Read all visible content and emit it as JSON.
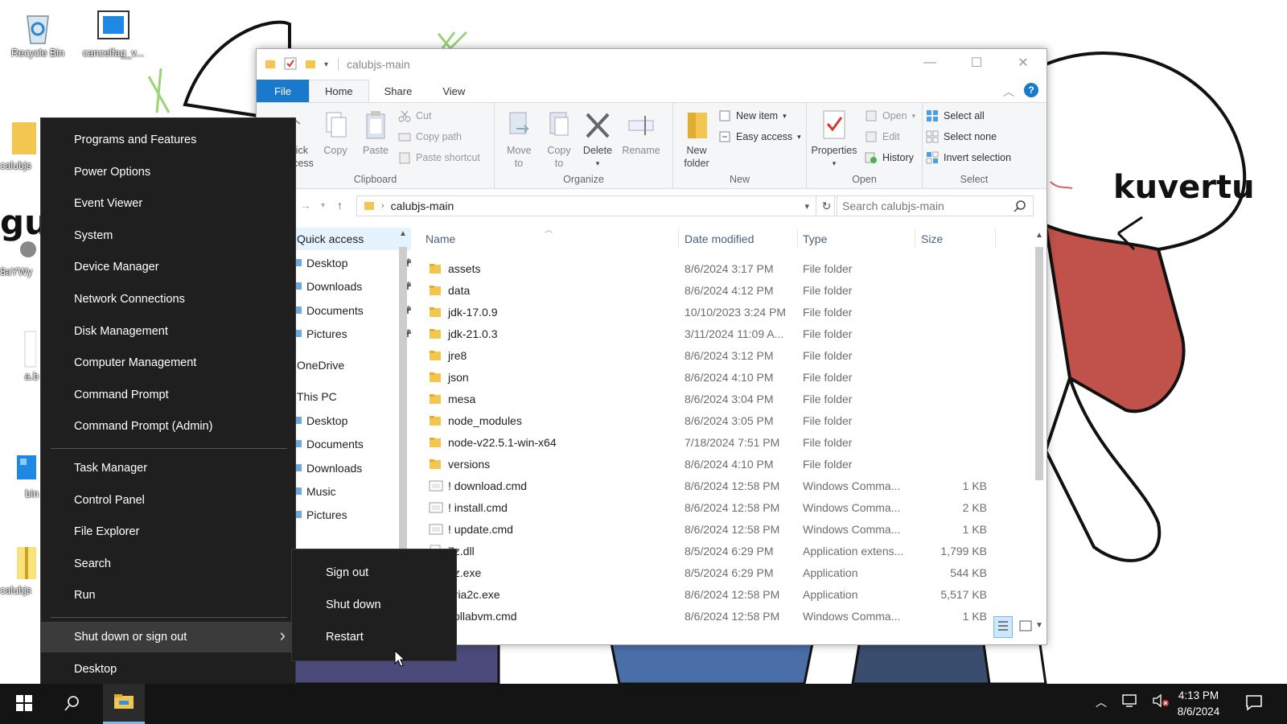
{
  "desktop": {
    "icons": [
      {
        "label": "Recycle Bin",
        "icon": "recycle-bin-icon"
      },
      {
        "label": "cancelfag_v...",
        "icon": "app-icon"
      },
      {
        "label": "calubjs",
        "icon": "folder-icon"
      },
      {
        "label": "8aYWy",
        "icon": "app-icon"
      },
      {
        "label": "a.b",
        "icon": "file-icon"
      },
      {
        "label": "bin",
        "icon": "package-icon"
      },
      {
        "label": "calubjs",
        "icon": "zip-folder-icon"
      }
    ],
    "wallpaper_text": {
      "left": "gu",
      "right": "kuvertu"
    }
  },
  "explorer": {
    "title": "calubjs-main",
    "tabs": [
      "File",
      "Home",
      "Share",
      "View"
    ],
    "ribbon": {
      "clipboard": {
        "group": "Clipboard",
        "quick_access": "Quick access",
        "copy": "Copy",
        "paste": "Paste",
        "cut": "Cut",
        "copy_path": "Copy path",
        "paste_shortcut": "Paste shortcut"
      },
      "organize": {
        "group": "Organize",
        "move_to": "Move to",
        "copy_to": "Copy to",
        "delete": "Delete",
        "rename": "Rename"
      },
      "new": {
        "group": "New",
        "new_folder": "New folder",
        "new_item": "New item",
        "easy_access": "Easy access"
      },
      "open": {
        "group": "Open",
        "properties": "Properties",
        "open": "Open",
        "edit": "Edit",
        "history": "History"
      },
      "select": {
        "group": "Select",
        "select_all": "Select all",
        "select_none": "Select none",
        "invert_selection": "Invert selection"
      }
    },
    "address": "calubjs-main",
    "search_placeholder": "Search calubjs-main",
    "nav": [
      {
        "label": "Quick access",
        "indent": 0,
        "pinned": false,
        "selected": true
      },
      {
        "label": "Desktop",
        "indent": 1,
        "pinned": true
      },
      {
        "label": "Downloads",
        "indent": 1,
        "pinned": true
      },
      {
        "label": "Documents",
        "indent": 1,
        "pinned": true
      },
      {
        "label": "Pictures",
        "indent": 1,
        "pinned": true
      },
      {
        "label": "OneDrive",
        "indent": 0,
        "pinned": false
      },
      {
        "label": "This PC",
        "indent": 0,
        "pinned": false
      },
      {
        "label": "Desktop",
        "indent": 1,
        "pinned": false
      },
      {
        "label": "Documents",
        "indent": 1,
        "pinned": false
      },
      {
        "label": "Downloads",
        "indent": 1,
        "pinned": false
      },
      {
        "label": "Music",
        "indent": 1,
        "pinned": false
      },
      {
        "label": "Pictures",
        "indent": 1,
        "pinned": false
      }
    ],
    "columns": {
      "name": "Name",
      "date": "Date modified",
      "type": "Type",
      "size": "Size"
    },
    "files": [
      {
        "name": "assets",
        "date": "8/6/2024 3:17 PM",
        "type": "File folder",
        "size": "",
        "kind": "folder"
      },
      {
        "name": "data",
        "date": "8/6/2024 4:12 PM",
        "type": "File folder",
        "size": "",
        "kind": "folder"
      },
      {
        "name": "jdk-17.0.9",
        "date": "10/10/2023 3:24 PM",
        "type": "File folder",
        "size": "",
        "kind": "folder"
      },
      {
        "name": "jdk-21.0.3",
        "date": "3/11/2024 11:09 A...",
        "type": "File folder",
        "size": "",
        "kind": "folder"
      },
      {
        "name": "jre8",
        "date": "8/6/2024 3:12 PM",
        "type": "File folder",
        "size": "",
        "kind": "folder"
      },
      {
        "name": "json",
        "date": "8/6/2024 4:10 PM",
        "type": "File folder",
        "size": "",
        "kind": "folder"
      },
      {
        "name": "mesa",
        "date": "8/6/2024 3:04 PM",
        "type": "File folder",
        "size": "",
        "kind": "folder"
      },
      {
        "name": "node_modules",
        "date": "8/6/2024 3:05 PM",
        "type": "File folder",
        "size": "",
        "kind": "folder"
      },
      {
        "name": "node-v22.5.1-win-x64",
        "date": "7/18/2024 7:51 PM",
        "type": "File folder",
        "size": "",
        "kind": "folder"
      },
      {
        "name": "versions",
        "date": "8/6/2024 4:10 PM",
        "type": "File folder",
        "size": "",
        "kind": "folder"
      },
      {
        "name": "! download.cmd",
        "date": "8/6/2024 12:58 PM",
        "type": "Windows Comma...",
        "size": "1 KB",
        "kind": "cmd"
      },
      {
        "name": "! install.cmd",
        "date": "8/6/2024 12:58 PM",
        "type": "Windows Comma...",
        "size": "2 KB",
        "kind": "cmd"
      },
      {
        "name": "! update.cmd",
        "date": "8/6/2024 12:58 PM",
        "type": "Windows Comma...",
        "size": "1 KB",
        "kind": "cmd"
      },
      {
        "name": "7z.dll",
        "date": "8/5/2024 6:29 PM",
        "type": "Application extens...",
        "size": "1,799 KB",
        "kind": "dll"
      },
      {
        "name": "7z.exe",
        "date": "8/5/2024 6:29 PM",
        "type": "Application",
        "size": "544 KB",
        "kind": "exe"
      },
      {
        "name": "aria2c.exe",
        "date": "8/6/2024 12:58 PM",
        "type": "Application",
        "size": "5,517 KB",
        "kind": "exe"
      },
      {
        "name": "collabvm.cmd",
        "date": "8/6/2024 12:58 PM",
        "type": "Windows Comma...",
        "size": "1 KB",
        "kind": "cmd"
      }
    ]
  },
  "winx_menu": {
    "items": [
      "Programs and Features",
      "Power Options",
      "Event Viewer",
      "System",
      "Device Manager",
      "Network Connections",
      "Disk Management",
      "Computer Management",
      "Command Prompt",
      "Command Prompt (Admin)",
      "Task Manager",
      "Control Panel",
      "File Explorer",
      "Search",
      "Run",
      "Shut down or sign out",
      "Desktop"
    ],
    "highlighted": "Shut down or sign out"
  },
  "shutdown_submenu": {
    "items": [
      "Sign out",
      "Shut down",
      "Restart"
    ]
  },
  "taskbar": {
    "time": "4:13 PM",
    "date": "8/6/2024"
  },
  "colors": {
    "accent": "#1979ca",
    "menu_bg": "#1f1f1f",
    "taskbar_bg": "#141414",
    "folder": "#f3c74f"
  }
}
